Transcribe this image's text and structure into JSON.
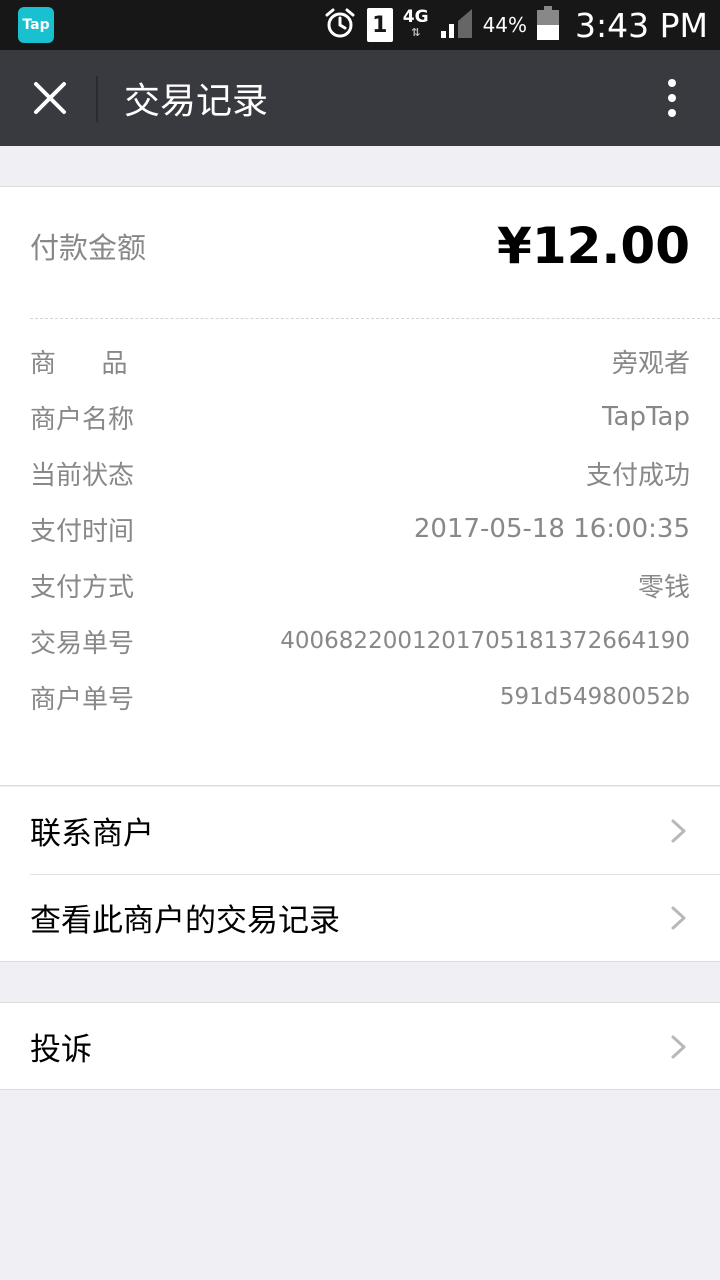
{
  "status_bar": {
    "app_badge": "Tap",
    "sim": "1",
    "network": "4G",
    "battery": "44%",
    "time": "3:43 PM"
  },
  "header": {
    "title": "交易记录",
    "close_icon": "close-icon",
    "more_icon": "more-vertical-icon"
  },
  "payment": {
    "amount_label": "付款金额",
    "amount_value": "¥12.00"
  },
  "details": [
    {
      "label": "商品",
      "value": "旁观者"
    },
    {
      "label": "商户名称",
      "value": "TapTap"
    },
    {
      "label": "当前状态",
      "value": "支付成功"
    },
    {
      "label": "支付时间",
      "value": "2017-05-18 16:00:35"
    },
    {
      "label": "支付方式",
      "value": "零钱"
    },
    {
      "label": "交易单号",
      "value": "4006822001201705181372664190"
    },
    {
      "label": "商户单号",
      "value": "591d54980052b"
    }
  ],
  "links": {
    "contact_merchant": "联系商户",
    "view_merchant_records": "查看此商户的交易记录",
    "complain": "投诉"
  },
  "colors": {
    "status_bar_bg": "#171717",
    "title_bar_bg": "#393a3f",
    "page_bg": "#efeff4",
    "app_badge": "#19c0d0"
  }
}
